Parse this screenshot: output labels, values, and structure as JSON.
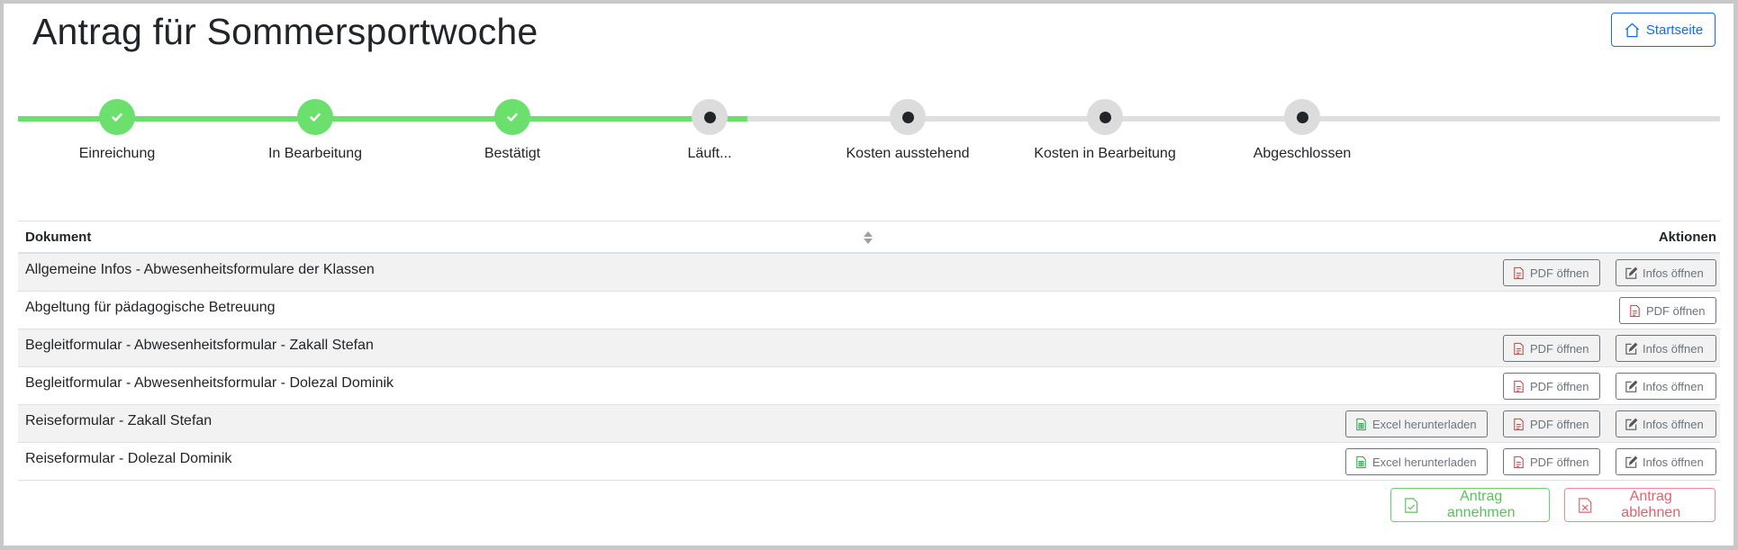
{
  "page": {
    "title": "Antrag für Sommersportwoche",
    "home_label": "Startseite"
  },
  "stepper": {
    "completed_count": 3,
    "steps": [
      {
        "label": "Einreichung",
        "status": "done"
      },
      {
        "label": "In Bearbeitung",
        "status": "done"
      },
      {
        "label": "Bestätigt",
        "status": "done"
      },
      {
        "label": "Läuft...",
        "status": "pending"
      },
      {
        "label": "Kosten ausstehend",
        "status": "pending"
      },
      {
        "label": "Kosten in Bearbeitung",
        "status": "pending"
      },
      {
        "label": "Abgeschlossen",
        "status": "pending"
      }
    ]
  },
  "table": {
    "col_document": "Dokument",
    "col_actions": "Aktionen",
    "actions": {
      "excel": "Excel herunterladen",
      "pdf": "PDF öffnen",
      "info": "Infos öffnen"
    },
    "rows": [
      {
        "title": "Allgemeine Infos - Abwesenheitsformulare der Klassen"
      },
      {
        "title": "Abgeltung für pädagogische Betreuung"
      },
      {
        "title": "Begleitformular - Abwesenheitsformular - Zakall Stefan"
      },
      {
        "title": "Begleitformular - Abwesenheitsformular - Dolezal Dominik"
      },
      {
        "title": "Reiseformular - Zakall Stefan"
      },
      {
        "title": "Reiseformular - Dolezal Dominik"
      }
    ]
  },
  "footer": {
    "accept_label": "Antrag annehmen",
    "reject_label": "Antrag ablehnen"
  },
  "colors": {
    "primary": "#0d6efd",
    "success": "#6ce06c",
    "danger": "#e0636a",
    "secondary": "#6c757d",
    "pending": "#dcdcdc"
  },
  "icons": {
    "home": "house-icon",
    "check": "check-icon",
    "pdf": "file-pdf-icon",
    "info": "pencil-square-icon",
    "excel": "file-spreadsheet-icon",
    "sort": "sort-icon",
    "accept": "file-check-icon",
    "reject": "file-x-icon"
  }
}
